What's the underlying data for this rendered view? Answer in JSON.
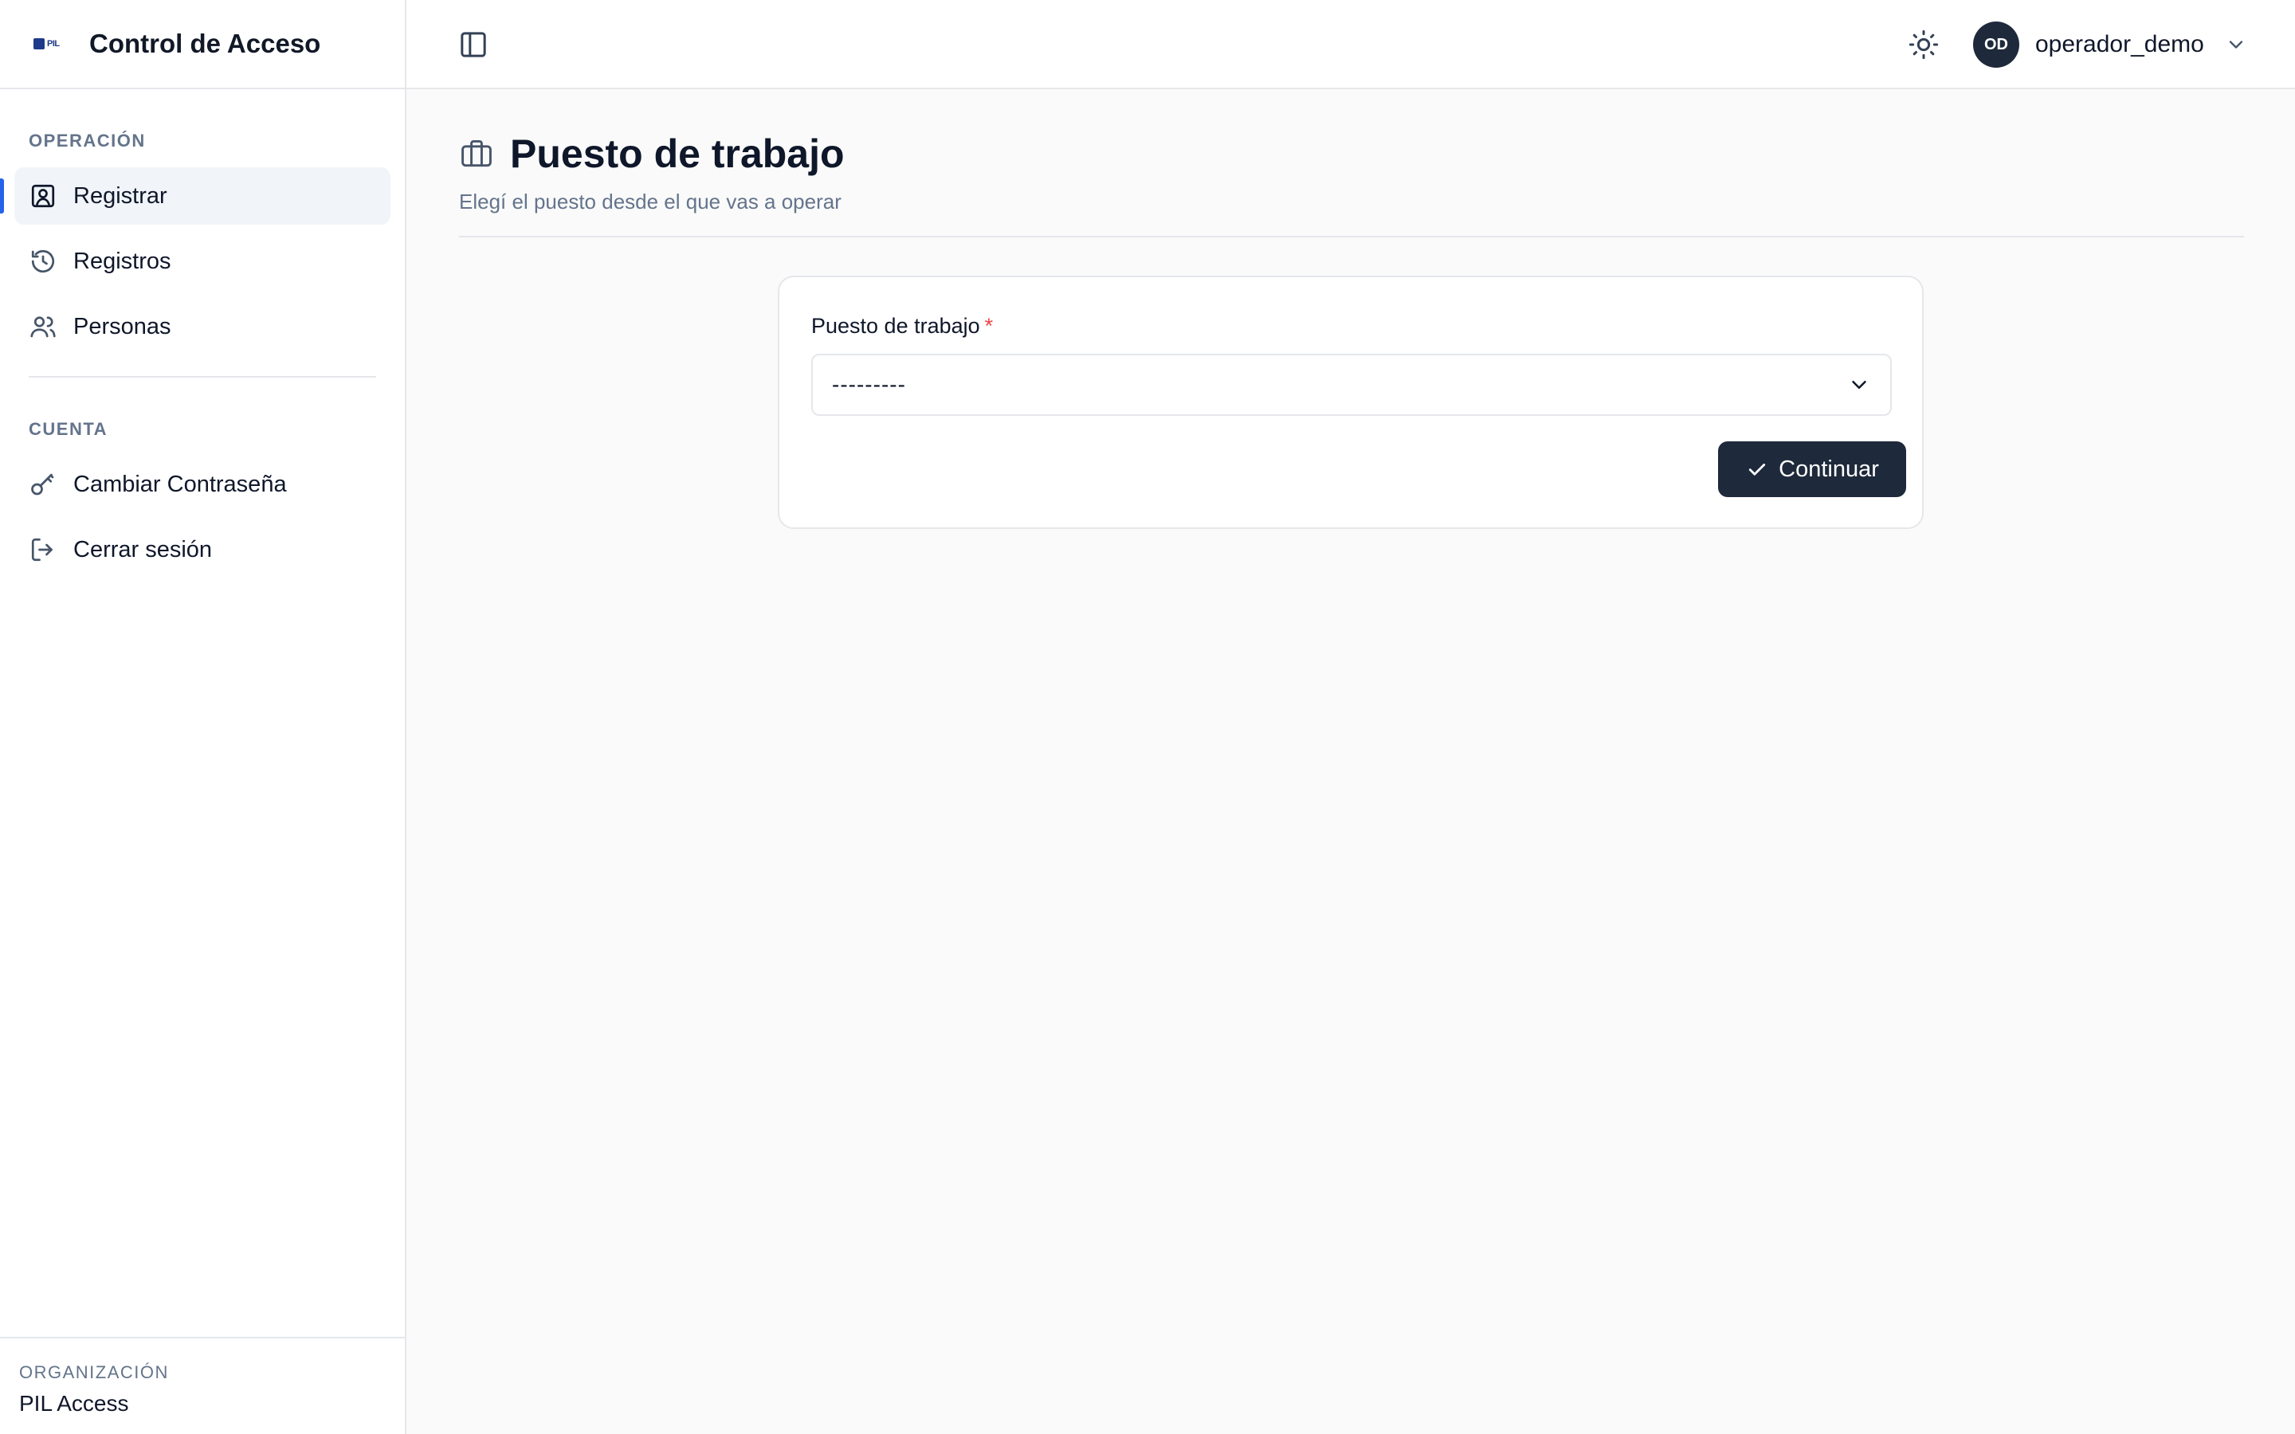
{
  "app": {
    "title": "Control de Acceso",
    "logo_text": "PIL"
  },
  "sidebar": {
    "sections": [
      {
        "label": "OPERACIÓN",
        "items": [
          {
            "label": "Registrar",
            "icon": "user-badge-icon",
            "active": true
          },
          {
            "label": "Registros",
            "icon": "history-icon",
            "active": false
          },
          {
            "label": "Personas",
            "icon": "users-icon",
            "active": false
          }
        ]
      },
      {
        "label": "CUENTA",
        "items": [
          {
            "label": "Cambiar Contraseña",
            "icon": "key-icon",
            "active": false
          },
          {
            "label": "Cerrar sesión",
            "icon": "logout-icon",
            "active": false
          }
        ]
      }
    ],
    "org": {
      "label": "ORGANIZACIÓN",
      "name": "PIL Access"
    }
  },
  "header": {
    "user": {
      "initials": "OD",
      "name": "operador_demo"
    }
  },
  "main": {
    "title": "Puesto de trabajo",
    "subtitle": "Elegí el puesto desde el que vas a operar",
    "form": {
      "field_label": "Puesto de trabajo",
      "required_mark": "*",
      "select_value": "---------",
      "submit_label": "Continuar"
    }
  },
  "colors": {
    "accent": "#2563eb",
    "primary_button": "#1e293b",
    "required": "#ef4444"
  }
}
